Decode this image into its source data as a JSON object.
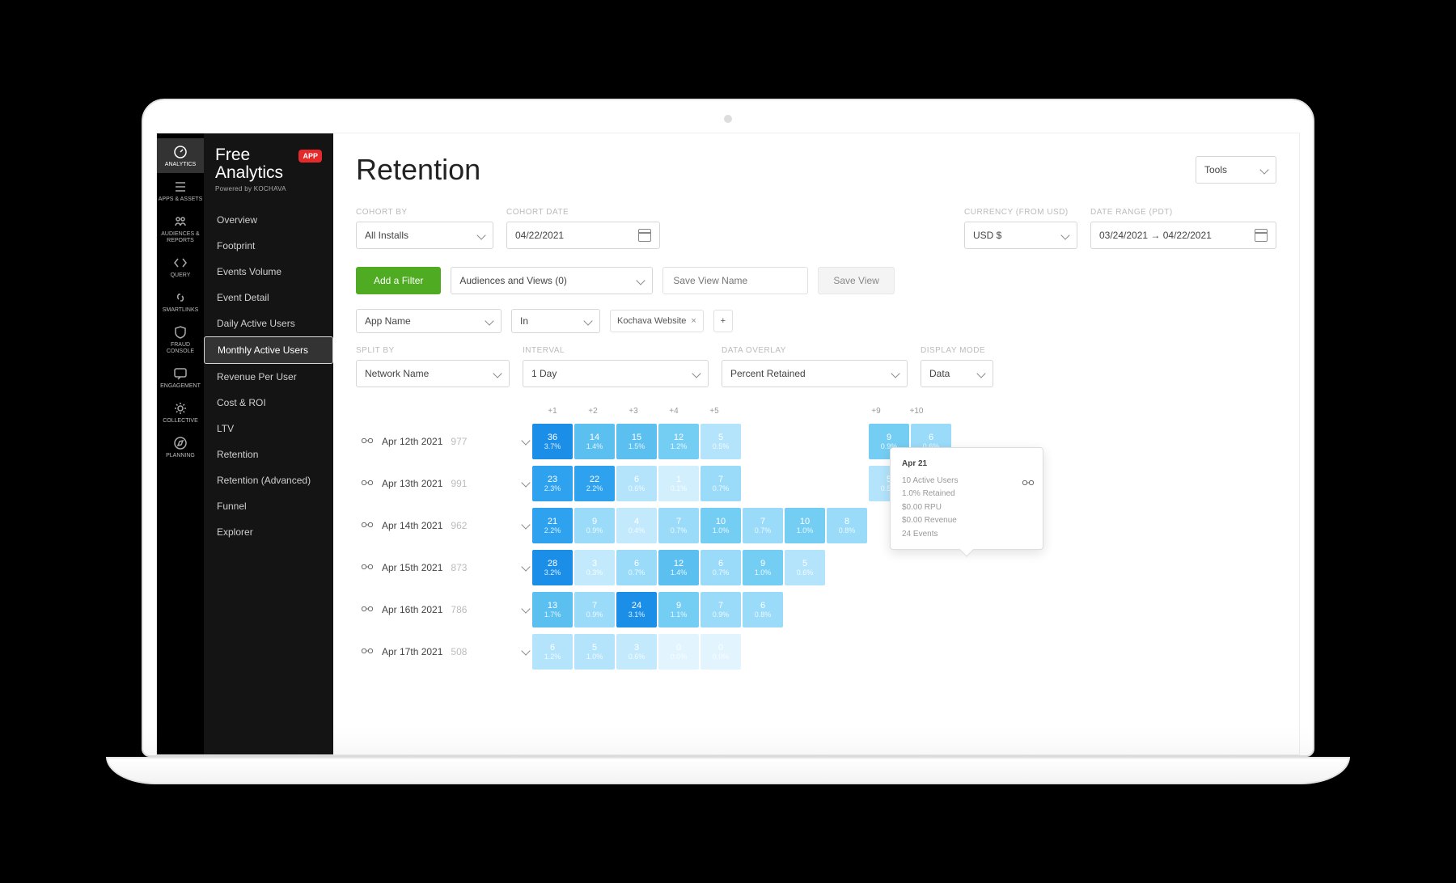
{
  "brand": {
    "line1": "Free",
    "line2": "Analytics",
    "badge": "APP",
    "powered": "Powered by KOCHAVA"
  },
  "rail": [
    {
      "label": "ANALYTICS",
      "icon": "gauge",
      "active": true
    },
    {
      "label": "APPS & ASSETS",
      "icon": "list"
    },
    {
      "label": "AUDIENCES & REPORTS",
      "icon": "people"
    },
    {
      "label": "QUERY",
      "icon": "code"
    },
    {
      "label": "SMARTLINKS",
      "icon": "link"
    },
    {
      "label": "FRAUD CONSOLE",
      "icon": "shield"
    },
    {
      "label": "ENGAGEMENT",
      "icon": "comment"
    },
    {
      "label": "COLLECTIVE",
      "icon": "gear"
    },
    {
      "label": "PLANNING",
      "icon": "compass"
    }
  ],
  "sidebar": [
    "Overview",
    "Footprint",
    "Events Volume",
    "Event Detail",
    "Daily Active Users",
    "Monthly Active Users",
    "Revenue Per User",
    "Cost & ROI",
    "LTV",
    "Retention",
    "Retention (Advanced)",
    "Funnel",
    "Explorer"
  ],
  "sidebarSelected": 5,
  "page": {
    "title": "Retention",
    "tools": "Tools"
  },
  "filters": {
    "cohortByLabel": "COHORT BY",
    "cohortBy": "All Installs",
    "cohortDateLabel": "COHORT DATE",
    "cohortDate": "04/22/2021",
    "currencyLabel": "CURRENCY (FROM USD)",
    "currency": "USD $",
    "dateRangeLabel": "DATE RANGE (PDT)",
    "dateRange": "03/24/2021 → 04/22/2021",
    "addFilter": "Add a Filter",
    "audiences": "Audiences and Views (0)",
    "saveViewPlaceholder": "Save View Name",
    "saveView": "Save View",
    "dim": "App Name",
    "op": "In",
    "val": "Kochava Website",
    "splitByLabel": "SPLIT BY",
    "splitBy": "Network Name",
    "intervalLabel": "INTERVAL",
    "interval": "1 Day",
    "overlayLabel": "DATA OVERLAY",
    "overlay": "Percent Retained",
    "displayLabel": "DISPLAY MODE",
    "display": "Data"
  },
  "headers": [
    "+1",
    "+2",
    "+3",
    "+4",
    "+5",
    "",
    "",
    "",
    "+9",
    "+10"
  ],
  "rows": [
    {
      "date": "Apr 12th 2021",
      "count": "977",
      "cells": [
        {
          "v": "36",
          "p": "3.7%",
          "c": "#1b8fe8"
        },
        {
          "v": "14",
          "p": "1.4%",
          "c": "#5bc0f0"
        },
        {
          "v": "15",
          "p": "1.5%",
          "c": "#5bc0f0"
        },
        {
          "v": "12",
          "p": "1.2%",
          "c": "#74cef4"
        },
        {
          "v": "5",
          "p": "0.5%",
          "c": "#b3e4fb"
        },
        null,
        null,
        null,
        {
          "v": "9",
          "p": "0.9%",
          "c": "#74cef4"
        },
        {
          "v": "6",
          "p": "0.6%",
          "c": "#99dbf9"
        }
      ]
    },
    {
      "date": "Apr 13th 2021",
      "count": "991",
      "cells": [
        {
          "v": "23",
          "p": "2.3%",
          "c": "#2ea2ee"
        },
        {
          "v": "22",
          "p": "2.2%",
          "c": "#2ea2ee"
        },
        {
          "v": "6",
          "p": "0.6%",
          "c": "#b3e4fb"
        },
        {
          "v": "1",
          "p": "0.1%",
          "c": "#d2effd"
        },
        {
          "v": "7",
          "p": "0.7%",
          "c": "#99dbf9"
        },
        null,
        null,
        null,
        {
          "v": "5",
          "p": "0.5%",
          "c": "#b3e4fb"
        }
      ]
    },
    {
      "date": "Apr 14th 2021",
      "count": "962",
      "cells": [
        {
          "v": "21",
          "p": "2.2%",
          "c": "#2ea2ee"
        },
        {
          "v": "9",
          "p": "0.9%",
          "c": "#99dbf9"
        },
        {
          "v": "4",
          "p": "0.4%",
          "c": "#c2eafc"
        },
        {
          "v": "7",
          "p": "0.7%",
          "c": "#99dbf9"
        },
        {
          "v": "10",
          "p": "1.0%",
          "c": "#74cef4"
        },
        {
          "v": "7",
          "p": "0.7%",
          "c": "#99dbf9"
        },
        {
          "v": "10",
          "p": "1.0%",
          "c": "#74cef4"
        },
        {
          "v": "8",
          "p": "0.8%",
          "c": "#99dbf9"
        }
      ]
    },
    {
      "date": "Apr 15th 2021",
      "count": "873",
      "cells": [
        {
          "v": "28",
          "p": "3.2%",
          "c": "#1b8fe8"
        },
        {
          "v": "3",
          "p": "0.3%",
          "c": "#c2eafc"
        },
        {
          "v": "6",
          "p": "0.7%",
          "c": "#99dbf9"
        },
        {
          "v": "12",
          "p": "1.4%",
          "c": "#5bc0f0"
        },
        {
          "v": "6",
          "p": "0.7%",
          "c": "#99dbf9"
        },
        {
          "v": "9",
          "p": "1.0%",
          "c": "#74cef4"
        },
        {
          "v": "5",
          "p": "0.6%",
          "c": "#b3e4fb"
        }
      ]
    },
    {
      "date": "Apr 16th 2021",
      "count": "786",
      "cells": [
        {
          "v": "13",
          "p": "1.7%",
          "c": "#5bc0f0"
        },
        {
          "v": "7",
          "p": "0.9%",
          "c": "#99dbf9"
        },
        {
          "v": "24",
          "p": "3.1%",
          "c": "#1b8fe8"
        },
        {
          "v": "9",
          "p": "1.1%",
          "c": "#74cef4"
        },
        {
          "v": "7",
          "p": "0.9%",
          "c": "#99dbf9"
        },
        {
          "v": "6",
          "p": "0.8%",
          "c": "#99dbf9"
        }
      ]
    },
    {
      "date": "Apr 17th 2021",
      "count": "508",
      "cells": [
        {
          "v": "6",
          "p": "1.2%",
          "c": "#b3e4fb"
        },
        {
          "v": "5",
          "p": "1.0%",
          "c": "#b3e4fb"
        },
        {
          "v": "3",
          "p": "0.6%",
          "c": "#c2eafc"
        },
        {
          "v": "0",
          "p": "0.0%",
          "c": "#e2f4fe"
        },
        {
          "v": "0",
          "p": "0.0%",
          "c": "#e2f4fe"
        }
      ]
    }
  ],
  "tooltip": {
    "title": "Apr 21",
    "lines": [
      "10 Active Users",
      "1.0% Retained",
      "$0.00 RPU",
      "$0.00 Revenue",
      "24 Events"
    ]
  }
}
